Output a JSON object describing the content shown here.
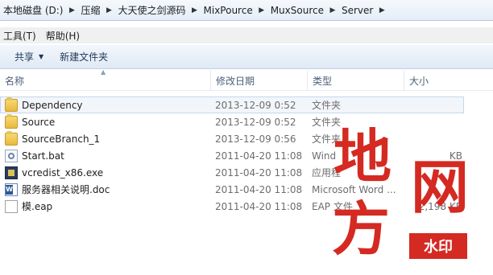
{
  "address_bar": {
    "crumbs": [
      "本地磁盘 (D:)",
      "压缩",
      "大天使之剑源码",
      "MixPource",
      "MuxSource",
      "Server"
    ]
  },
  "menu": {
    "tools": "工具(T)",
    "help": "帮助(H)"
  },
  "toolbar": {
    "share": "共享",
    "new_folder": "新建文件夹"
  },
  "columns": {
    "name": "名称",
    "modified": "修改日期",
    "type": "类型",
    "size": "大小"
  },
  "files": [
    {
      "name": "Dependency",
      "modified": "2013-12-09 0:52",
      "type": "文件夹",
      "size": "",
      "icon": "folder-icon"
    },
    {
      "name": "Source",
      "modified": "2013-12-09 0:52",
      "type": "文件夹",
      "size": "",
      "icon": "folder-icon"
    },
    {
      "name": "SourceBranch_1",
      "modified": "2013-12-09 0:56",
      "type": "文件夹",
      "size": "",
      "icon": "folder-icon"
    },
    {
      "name": "Start.bat",
      "modified": "2011-04-20 11:08",
      "type": "Wind",
      "size": "KB",
      "icon": "batch-file-icon"
    },
    {
      "name": "vcredist_x86.exe",
      "modified": "2011-04-20 11:08",
      "type": "应用程",
      "size": "",
      "icon": "exe-file-icon"
    },
    {
      "name": "服务器相关说明.doc",
      "modified": "2011-04-20 11:08",
      "type": "Microsoft Word ...",
      "size": "",
      "icon": "word-doc-icon"
    },
    {
      "name": "模.eap",
      "modified": "2011-04-20 11:08",
      "type": "EAP 文件",
      "size": "2,198 KB",
      "icon": "file-icon"
    }
  ],
  "watermark": {
    "text": "地方网",
    "badge": "水印",
    "color": "#d42a22"
  }
}
